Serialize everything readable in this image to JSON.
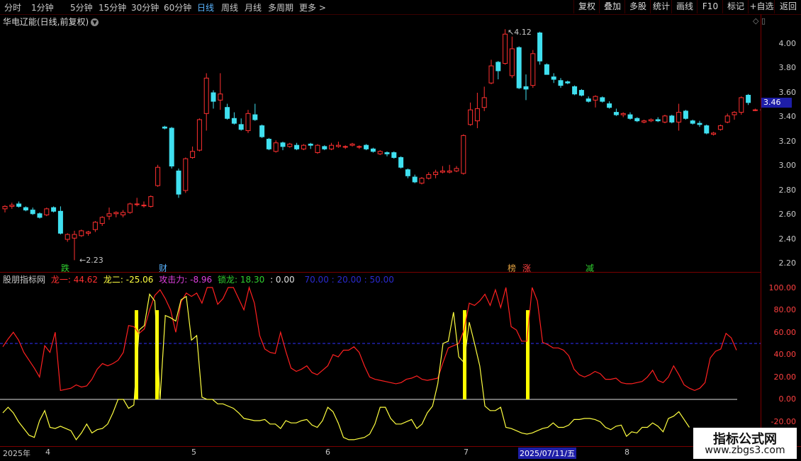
{
  "toolbar": {
    "periods": [
      "分时",
      "1分钟",
      "5分钟",
      "15分钟",
      "30分钟",
      "60分钟",
      "日线",
      "周线",
      "月线",
      "多周期",
      "更多 >"
    ],
    "active_period": "日线",
    "tools": [
      "复权",
      "叠加",
      "多股",
      "统计",
      "画线",
      "F10",
      "标记",
      "+自选",
      "返回"
    ]
  },
  "stock": {
    "title": "华电辽能(日线,前复权)"
  },
  "price_axis": {
    "labels": [
      "4.00",
      "3.80",
      "3.60",
      "3.40",
      "3.20",
      "3.00",
      "2.80",
      "2.60",
      "2.40",
      "2.20"
    ],
    "current_price": "3.46"
  },
  "indicator_axis": {
    "labels": [
      "100.00",
      "80.00",
      "60.00",
      "40.00",
      "20.00",
      "0.00",
      "-20.00"
    ]
  },
  "annotations": {
    "high": "4.12",
    "low": "2.23"
  },
  "signal_marks": [
    {
      "text": "跌",
      "color": "#30d030"
    },
    {
      "text": "财",
      "color": "#5ab4ff"
    },
    {
      "text": "榜",
      "color": "#e0a040"
    },
    {
      "text": "涨",
      "color": "#ff4040"
    },
    {
      "text": "减",
      "color": "#30d030"
    }
  ],
  "indicator": {
    "name": "股朋指标网",
    "l1": "龙一: 44.62",
    "l2": "龙二: -25.06",
    "atk": "攻击力: -8.96",
    "lock": "锁龙: 18.30",
    "extra": ": 0.00",
    "levels": "70.00 : 20.00 : 50.00"
  },
  "date_axis": [
    "2025年",
    "4",
    "5",
    "6",
    "7",
    "2025/07/11/五",
    "8"
  ],
  "watermark": {
    "line1": "指标公式网",
    "line2": "www.zbgs3.com"
  },
  "colors": {
    "up": "#ff3030",
    "down": "#40e0f0",
    "line1": "#ff2020",
    "line2": "#ffff40",
    "signal": "#ffff00",
    "dash": "#3030ff"
  },
  "chart_data": {
    "type": "candlestick",
    "candles": [
      [
        2.65,
        2.68,
        2.62,
        2.67
      ],
      [
        2.67,
        2.7,
        2.65,
        2.68
      ],
      [
        2.69,
        2.71,
        2.66,
        2.67
      ],
      [
        2.66,
        2.67,
        2.63,
        2.64
      ],
      [
        2.64,
        2.66,
        2.6,
        2.61
      ],
      [
        2.61,
        2.62,
        2.57,
        2.58
      ],
      [
        2.6,
        2.66,
        2.59,
        2.65
      ],
      [
        2.66,
        2.67,
        2.62,
        2.63
      ],
      [
        2.63,
        2.67,
        2.44,
        2.45
      ],
      [
        2.4,
        2.45,
        2.38,
        2.44
      ],
      [
        2.41,
        2.47,
        2.23,
        2.44
      ],
      [
        2.43,
        2.48,
        2.42,
        2.47
      ],
      [
        2.45,
        2.47,
        2.43,
        2.46
      ],
      [
        2.48,
        2.55,
        2.46,
        2.54
      ],
      [
        2.53,
        2.59,
        2.51,
        2.58
      ],
      [
        2.59,
        2.66,
        2.56,
        2.61
      ],
      [
        2.61,
        2.63,
        2.58,
        2.62
      ],
      [
        2.6,
        2.64,
        2.58,
        2.62
      ],
      [
        2.62,
        2.7,
        2.61,
        2.69
      ],
      [
        2.69,
        2.74,
        2.67,
        2.69
      ],
      [
        2.68,
        2.71,
        2.66,
        2.68
      ],
      [
        2.67,
        2.76,
        2.66,
        2.75
      ],
      [
        2.84,
        3.01,
        2.83,
        2.99
      ],
      [
        3.32,
        3.33,
        3.3,
        3.31
      ],
      [
        3.31,
        3.32,
        2.98,
        3.0
      ],
      [
        2.96,
        2.98,
        2.74,
        2.77
      ],
      [
        2.8,
        3.07,
        2.78,
        3.06
      ],
      [
        3.07,
        3.16,
        3.06,
        3.12
      ],
      [
        3.13,
        3.39,
        3.12,
        3.38
      ],
      [
        3.43,
        3.76,
        3.29,
        3.72
      ],
      [
        3.6,
        3.62,
        3.47,
        3.53
      ],
      [
        3.54,
        3.76,
        3.46,
        3.59
      ],
      [
        3.48,
        3.51,
        3.38,
        3.39
      ],
      [
        3.39,
        3.44,
        3.34,
        3.35
      ],
      [
        3.34,
        3.39,
        3.29,
        3.3
      ],
      [
        3.29,
        3.46,
        3.27,
        3.43
      ],
      [
        3.42,
        3.51,
        3.37,
        3.38
      ],
      [
        3.33,
        3.34,
        3.23,
        3.24
      ],
      [
        3.22,
        3.23,
        3.13,
        3.14
      ],
      [
        3.12,
        3.21,
        3.11,
        3.19
      ],
      [
        3.19,
        3.2,
        3.13,
        3.16
      ],
      [
        3.16,
        3.19,
        3.15,
        3.18
      ],
      [
        3.17,
        3.19,
        3.13,
        3.14
      ],
      [
        3.14,
        3.18,
        3.13,
        3.17
      ],
      [
        3.18,
        3.19,
        3.14,
        3.17
      ],
      [
        3.11,
        3.18,
        3.1,
        3.17
      ],
      [
        3.16,
        3.17,
        3.13,
        3.14
      ],
      [
        3.14,
        3.19,
        3.13,
        3.17
      ],
      [
        3.16,
        3.2,
        3.15,
        3.17
      ],
      [
        3.16,
        3.17,
        3.14,
        3.16
      ],
      [
        3.17,
        3.19,
        3.16,
        3.18
      ],
      [
        3.16,
        3.17,
        3.14,
        3.16
      ],
      [
        3.17,
        3.18,
        3.13,
        3.14
      ],
      [
        3.14,
        3.15,
        3.11,
        3.12
      ],
      [
        3.1,
        3.13,
        3.09,
        3.12
      ],
      [
        3.11,
        3.12,
        3.08,
        3.1
      ],
      [
        3.11,
        3.12,
        3.06,
        3.07
      ],
      [
        3.07,
        3.08,
        2.98,
        2.99
      ],
      [
        2.97,
        2.98,
        2.9,
        2.92
      ],
      [
        2.91,
        2.93,
        2.86,
        2.87
      ],
      [
        2.86,
        2.91,
        2.85,
        2.9
      ],
      [
        2.9,
        2.95,
        2.89,
        2.93
      ],
      [
        2.93,
        2.97,
        2.9,
        2.95
      ],
      [
        2.95,
        3.0,
        2.94,
        2.96
      ],
      [
        2.95,
        3.01,
        2.94,
        2.96
      ],
      [
        2.96,
        3.0,
        2.95,
        2.98
      ],
      [
        2.94,
        3.26,
        2.93,
        3.25
      ],
      [
        3.34,
        3.52,
        3.33,
        3.46
      ],
      [
        3.37,
        3.6,
        3.31,
        3.47
      ],
      [
        3.48,
        3.65,
        3.45,
        3.56
      ],
      [
        3.68,
        3.87,
        3.67,
        3.82
      ],
      [
        3.85,
        3.86,
        3.71,
        3.78
      ],
      [
        3.84,
        4.12,
        3.83,
        4.08
      ],
      [
        3.74,
        4.06,
        3.72,
        3.96
      ],
      [
        3.97,
        3.98,
        3.63,
        3.64
      ],
      [
        3.65,
        3.75,
        3.54,
        3.63
      ],
      [
        3.66,
        3.95,
        3.64,
        3.92
      ],
      [
        4.09,
        4.1,
        3.83,
        3.86
      ],
      [
        3.83,
        3.84,
        3.75,
        3.75
      ],
      [
        3.73,
        3.76,
        3.68,
        3.71
      ],
      [
        3.7,
        3.72,
        3.64,
        3.66
      ],
      [
        3.69,
        3.7,
        3.67,
        3.68
      ],
      [
        3.65,
        3.66,
        3.58,
        3.59
      ],
      [
        3.62,
        3.63,
        3.57,
        3.58
      ],
      [
        3.55,
        3.57,
        3.52,
        3.53
      ],
      [
        3.54,
        3.58,
        3.48,
        3.57
      ],
      [
        3.56,
        3.57,
        3.52,
        3.53
      ],
      [
        3.51,
        3.53,
        3.47,
        3.48
      ],
      [
        3.44,
        3.47,
        3.41,
        3.42
      ],
      [
        3.42,
        3.44,
        3.4,
        3.43
      ],
      [
        3.42,
        3.44,
        3.38,
        3.39
      ],
      [
        3.39,
        3.4,
        3.36,
        3.37
      ],
      [
        3.36,
        3.38,
        3.35,
        3.37
      ],
      [
        3.37,
        3.39,
        3.36,
        3.38
      ],
      [
        3.38,
        3.4,
        3.36,
        3.37
      ],
      [
        3.36,
        3.42,
        3.35,
        3.41
      ],
      [
        3.41,
        3.42,
        3.35,
        3.36
      ],
      [
        3.36,
        3.51,
        3.29,
        3.44
      ],
      [
        3.45,
        3.46,
        3.38,
        3.39
      ],
      [
        3.37,
        3.38,
        3.34,
        3.35
      ],
      [
        3.35,
        3.37,
        3.32,
        3.34
      ],
      [
        3.33,
        3.34,
        3.26,
        3.27
      ],
      [
        3.26,
        3.28,
        3.25,
        3.27
      ],
      [
        3.3,
        3.34,
        3.29,
        3.33
      ],
      [
        3.36,
        3.43,
        3.35,
        3.41
      ],
      [
        3.42,
        3.45,
        3.38,
        3.44
      ],
      [
        3.44,
        3.57,
        3.42,
        3.56
      ],
      [
        3.58,
        3.59,
        3.5,
        3.52
      ],
      [
        3.46,
        3.47,
        3.45,
        3.46
      ]
    ],
    "line1_values": [
      47,
      54,
      60,
      53,
      42,
      35,
      28,
      20,
      48,
      42,
      60,
      8,
      9,
      10,
      13,
      11,
      12,
      18,
      27,
      32,
      30,
      32,
      35,
      42,
      66,
      65,
      59,
      63,
      80,
      93,
      98,
      90,
      80,
      60,
      87,
      95,
      92,
      95,
      86,
      100,
      100,
      85,
      90,
      100,
      100,
      90,
      80,
      100,
      86,
      57,
      45,
      42,
      41,
      60,
      43,
      28,
      25,
      27,
      30,
      24,
      22,
      26,
      30,
      40,
      38,
      44,
      44,
      47,
      42,
      30,
      20,
      18,
      17,
      16,
      15,
      14,
      15,
      18,
      19,
      21,
      18,
      17,
      18,
      19,
      33,
      46,
      48,
      50,
      62,
      86,
      84,
      88,
      94,
      84,
      98,
      82,
      100,
      65,
      62,
      52,
      52,
      100,
      88,
      51,
      49,
      46,
      46,
      44,
      39,
      27,
      22,
      20,
      22,
      25,
      23,
      18,
      18,
      19,
      15,
      14,
      14,
      15,
      16,
      20,
      26,
      17,
      15,
      20,
      30,
      22,
      13,
      10,
      8,
      10,
      15,
      37,
      43,
      45,
      59,
      55,
      44
    ],
    "line2_values": [
      -12,
      -7,
      -12,
      -20,
      -26,
      -32,
      -34,
      -19,
      -10,
      -25,
      -26,
      -24,
      -26,
      -28,
      -36,
      -30,
      -22,
      -30,
      -27,
      -26,
      -22,
      -12,
      0,
      0,
      -8,
      -5,
      62,
      66,
      94,
      88,
      0,
      75,
      73,
      70,
      89,
      92,
      53,
      57,
      2,
      0,
      0,
      -4,
      -4,
      -6,
      -8,
      -12,
      -17,
      -18,
      -19,
      -19,
      -18,
      -22,
      -22,
      -26,
      -19,
      -21,
      -21,
      -19,
      -18,
      -23,
      -25,
      -19,
      -7,
      -11,
      -21,
      -34,
      -36,
      -36,
      -35,
      -34,
      -31,
      -22,
      -7,
      -7,
      -17,
      -22,
      -22,
      -20,
      -18,
      -26,
      -22,
      -12,
      -6,
      14,
      50,
      52,
      78,
      38,
      33,
      69,
      50,
      30,
      -6,
      -10,
      -10,
      -7,
      -25,
      -26,
      -28,
      -30,
      -31,
      -30,
      -28,
      -26,
      -25,
      -21,
      -25,
      -25,
      -23,
      -18,
      -18,
      -17,
      -17,
      -18,
      -20,
      -25,
      -27,
      -24,
      -23,
      -33,
      -29,
      -30,
      -25,
      -25,
      -21,
      -24,
      -29,
      -17,
      -15,
      -11,
      -18,
      -25
    ]
  }
}
